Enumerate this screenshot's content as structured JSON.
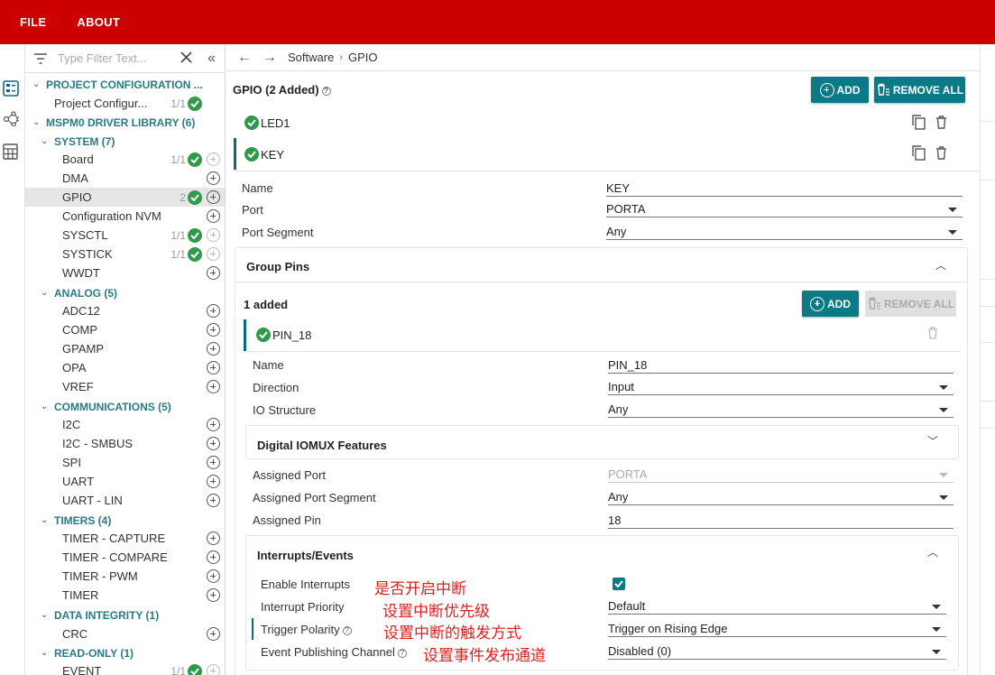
{
  "menu": {
    "file": "FILE",
    "about": "ABOUT"
  },
  "filter": {
    "placeholder": "Type Filter Text..."
  },
  "sidebar": {
    "project_cat": "PROJECT CONFIGURATION ...",
    "project_item": "Project Configur...",
    "project_count": "1/1",
    "driver_cat": "MSPM0 DRIVER LIBRARY (6)",
    "system_cat": "SYSTEM (7)",
    "system_items": [
      {
        "label": "Board",
        "count": "1/1"
      },
      {
        "label": "DMA",
        "count": ""
      },
      {
        "label": "GPIO",
        "count": "2"
      },
      {
        "label": "Configuration NVM",
        "count": ""
      },
      {
        "label": "SYSCTL",
        "count": "1/1"
      },
      {
        "label": "SYSTICK",
        "count": "1/1"
      },
      {
        "label": "WWDT",
        "count": ""
      }
    ],
    "analog_cat": "ANALOG (5)",
    "analog_items": [
      "ADC12",
      "COMP",
      "GPAMP",
      "OPA",
      "VREF"
    ],
    "comm_cat": "COMMUNICATIONS (5)",
    "comm_items": [
      "I2C",
      "I2C - SMBUS",
      "SPI",
      "UART",
      "UART - LIN"
    ],
    "timers_cat": "TIMERS (4)",
    "timers_items": [
      "TIMER - CAPTURE",
      "TIMER - COMPARE",
      "TIMER - PWM",
      "TIMER"
    ],
    "integrity_cat": "DATA INTEGRITY (1)",
    "integrity_items": [
      "CRC"
    ],
    "readonly_cat": "READ-ONLY (1)",
    "readonly_items": [
      {
        "label": "EVENT",
        "count": "1/1"
      }
    ]
  },
  "breadcrumb": {
    "root": "Software",
    "current": "GPIO"
  },
  "gpio": {
    "title": "GPIO (2 Added)",
    "add": "ADD",
    "remove_all": "REMOVE ALL",
    "instances": [
      "LED1",
      "KEY"
    ],
    "name_label": "Name",
    "name_value": "KEY",
    "port_label": "Port",
    "port_value": "PORTA",
    "segment_label": "Port Segment",
    "segment_value": "Any"
  },
  "group_pins": {
    "title": "Group Pins",
    "added": "1 added",
    "add": "ADD",
    "remove_all": "REMOVE ALL",
    "pin": "PIN_18",
    "name_label": "Name",
    "name_value": "PIN_18",
    "direction_label": "Direction",
    "direction_value": "Input",
    "io_label": "IO Structure",
    "io_value": "Any"
  },
  "iomux": {
    "title": "Digital IOMUX Features",
    "port_label": "Assigned Port",
    "port_value": "PORTA",
    "segment_label": "Assigned Port Segment",
    "segment_value": "Any",
    "pin_label": "Assigned Pin",
    "pin_value": "18"
  },
  "interrupts": {
    "title": "Interrupts/Events",
    "enable_label": "Enable Interrupts",
    "priority_label": "Interrupt Priority",
    "priority_value": "Default",
    "trigger_label": "Trigger Polarity",
    "trigger_value": "Trigger on Rising Edge",
    "channel_label": "Event Publishing Channel",
    "channel_value": "Disabled (0)",
    "enable_checked": true
  },
  "annotations": {
    "enable": "是否开启中断",
    "priority": "设置中断优先级",
    "trigger": "设置中断的触发方式",
    "channel": "设置事件发布通道"
  },
  "colors": {
    "topbar": "#cc0000",
    "accent": "#0a7a86",
    "check": "#2e9a4a",
    "annotation": "#e02020"
  }
}
